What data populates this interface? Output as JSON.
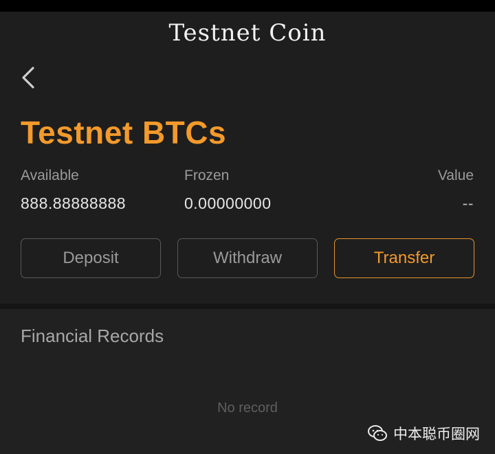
{
  "header": {
    "app_title": "Testnet Coin",
    "back_icon": "chevron-left-icon"
  },
  "coin": {
    "title": "Testnet BTCs",
    "accent_color": "#f39a2b"
  },
  "balances": {
    "available_label": "Available",
    "available_value": "888.88888888",
    "frozen_label": "Frozen",
    "frozen_value": "0.00000000",
    "value_label": "Value",
    "value_value": "--"
  },
  "actions": {
    "deposit": "Deposit",
    "withdraw": "Withdraw",
    "transfer": "Transfer"
  },
  "records": {
    "title": "Financial Records",
    "empty_text": "No record"
  },
  "watermark": {
    "text": "中本聪币圈网",
    "icon": "wechat-icon"
  }
}
